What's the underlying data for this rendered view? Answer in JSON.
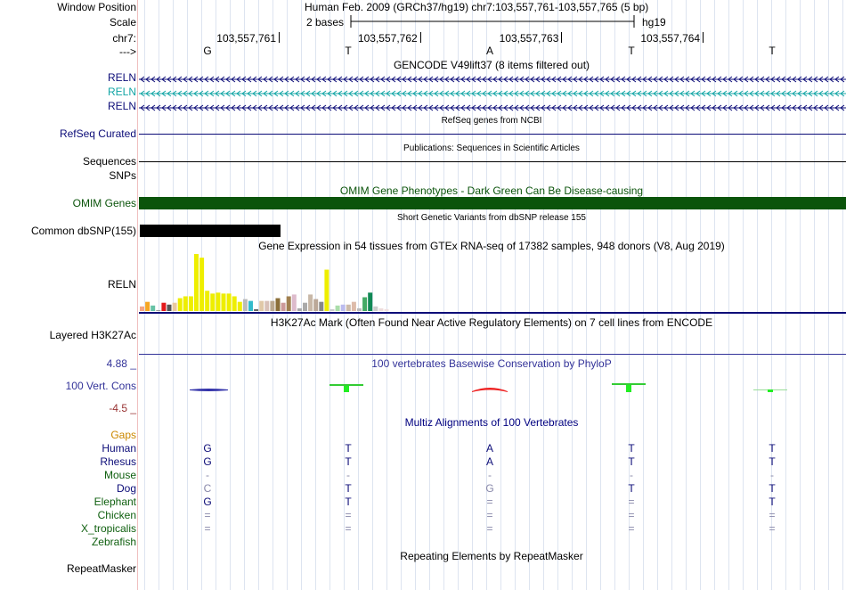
{
  "position": {
    "label": "Window Position",
    "text": "Human Feb. 2009 (GRCh37/hg19)   chr7:103,557,761-103,557,765 (5 bp)"
  },
  "scale": {
    "label": "Scale",
    "bases": "2 bases",
    "assembly": "hg19"
  },
  "chrom": {
    "label": "chr7:",
    "ticks": [
      "103,557,761",
      "103,557,762",
      "103,557,763",
      "103,557,764"
    ]
  },
  "bases": {
    "label": "--->",
    "letters": [
      "G",
      "T",
      "A",
      "T",
      "T"
    ]
  },
  "gencode": {
    "title": "GENCODE V49lift37 (8 items filtered out)",
    "genes": [
      {
        "name": "RELN",
        "color": "#0c0c78"
      },
      {
        "name": "RELN",
        "color": "#12a5a5"
      },
      {
        "name": "RELN",
        "color": "#0c0c78"
      }
    ]
  },
  "refseq": {
    "title": "RefSeq genes from NCBI",
    "label": "RefSeq Curated",
    "color": "#0c0c78"
  },
  "pubs": {
    "title": "Publications: Sequences in Scientific Articles",
    "label": "Sequences"
  },
  "snps_label": "SNPs",
  "omim": {
    "title": "OMIM Gene Phenotypes - Dark Green Can Be Disease-causing",
    "label": "OMIM Genes",
    "color": "#0b540b"
  },
  "dbsnp": {
    "title": "Short Genetic Variants from dbSNP release 155",
    "label": "Common dbSNP(155)"
  },
  "gtex": {
    "title": "Gene Expression in 54 tissues from GTEx RNA-seq of 17382 samples, 948 donors (V8, Aug 2019)",
    "label": "RELN",
    "bars": [
      {
        "value": 5,
        "color": "#f4a582"
      },
      {
        "value": 10,
        "color": "#f5a623"
      },
      {
        "value": 6,
        "color": "#66c2a5"
      },
      {
        "value": 1,
        "color": "#999999"
      },
      {
        "value": 9,
        "color": "#e31a1c"
      },
      {
        "value": 7,
        "color": "#555555"
      },
      {
        "value": 9,
        "color": "#e8c9a0"
      },
      {
        "value": 14,
        "color": "#eeee00"
      },
      {
        "value": 16,
        "color": "#eeee00"
      },
      {
        "value": 16,
        "color": "#eeee00"
      },
      {
        "value": 62,
        "color": "#eeee00"
      },
      {
        "value": 58,
        "color": "#eeee00"
      },
      {
        "value": 22,
        "color": "#eeee00"
      },
      {
        "value": 19,
        "color": "#eeee00"
      },
      {
        "value": 20,
        "color": "#eeee00"
      },
      {
        "value": 19,
        "color": "#eeee00"
      },
      {
        "value": 19,
        "color": "#eeee00"
      },
      {
        "value": 16,
        "color": "#eeee00"
      },
      {
        "value": 10,
        "color": "#eeee00"
      },
      {
        "value": 13,
        "color": "#bbbbbb"
      },
      {
        "value": 11,
        "color": "#33bbcc"
      },
      {
        "value": 2,
        "color": "#666666"
      },
      {
        "value": 11,
        "color": "#e0c8a8"
      },
      {
        "value": 11,
        "color": "#d8c0b8"
      },
      {
        "value": 11,
        "color": "#bba88f"
      },
      {
        "value": 14,
        "color": "#8b6f3a"
      },
      {
        "value": 9,
        "color": "#cc9999"
      },
      {
        "value": 16,
        "color": "#a08050"
      },
      {
        "value": 18,
        "color": "#ddbbcc"
      },
      {
        "value": 3,
        "color": "#aaaaaa"
      },
      {
        "value": 9,
        "color": "#aaaaaa"
      },
      {
        "value": 18,
        "color": "#c8b8a8"
      },
      {
        "value": 13,
        "color": "#bba898"
      },
      {
        "value": 10,
        "color": "#888888"
      },
      {
        "value": 45,
        "color": "#eeee00"
      },
      {
        "value": 2,
        "color": "#cccccc"
      },
      {
        "value": 6,
        "color": "#aaddaa"
      },
      {
        "value": 7,
        "color": "#bbbbee"
      },
      {
        "value": 7,
        "color": "#ccbbaa"
      },
      {
        "value": 10,
        "color": "#ddbbaa"
      },
      {
        "value": 3,
        "color": "#bbbbbb"
      },
      {
        "value": 15,
        "color": "#44aa66"
      },
      {
        "value": 20,
        "color": "#118855"
      },
      {
        "value": 5,
        "color": "#cccccc"
      },
      {
        "value": 3,
        "color": "#eedddd"
      },
      {
        "value": 2,
        "color": "#f0e0e0"
      }
    ]
  },
  "h3k27ac": {
    "title": "H3K27Ac Mark (Often Found Near Active Regulatory Elements) on 7 cell lines from ENCODE",
    "label": "Layered H3K27Ac"
  },
  "phylop": {
    "title": "100 vertebrates Basewise Conservation by PhyloP",
    "label": "100 Vert. Cons",
    "max": "4.88 _",
    "min": "-4.5 _",
    "max_color": "#333399",
    "min_color": "#993333",
    "title_color": "#333399"
  },
  "multiz": {
    "title": "Multiz Alignments of 100 Vertebrates",
    "title_color": "#000080",
    "gaps": {
      "label": "Gaps",
      "color": "#cc8800"
    },
    "species": [
      {
        "name": "Human",
        "color": "#0c0c78",
        "bases": [
          "G",
          "T",
          "A",
          "T",
          "T"
        ]
      },
      {
        "name": "Rhesus",
        "color": "#0c0c78",
        "bases": [
          "G",
          "T",
          "A",
          "T",
          "T"
        ]
      },
      {
        "name": "Mouse",
        "color": "#106010",
        "bases": [
          "-",
          "-",
          "-",
          "-",
          "-"
        ]
      },
      {
        "name": "Dog",
        "color": "#0c0c78",
        "bases": [
          "C",
          "T",
          "G",
          "T",
          "T"
        ]
      },
      {
        "name": "Elephant",
        "color": "#106010",
        "bases": [
          "G",
          "T",
          "=",
          "=",
          "T"
        ]
      },
      {
        "name": "Chicken",
        "color": "#106010",
        "bases": [
          "=",
          "=",
          "=",
          "=",
          "="
        ]
      },
      {
        "name": "X_tropicalis",
        "color": "#106010",
        "bases": [
          "=",
          "=",
          "=",
          "=",
          "="
        ]
      },
      {
        "name": "Zebrafish",
        "color": "#106010",
        "bases": [
          "",
          "",
          "",
          "",
          ""
        ]
      }
    ]
  },
  "repeatmasker": {
    "title": "Repeating Elements by RepeatMasker",
    "label": "RepeatMasker"
  }
}
